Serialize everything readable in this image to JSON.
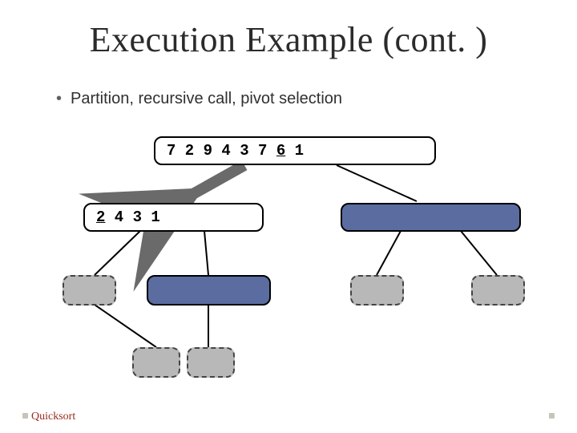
{
  "title": "Execution Example (cont. )",
  "bullet": "Partition, recursive call, pivot selection",
  "footer": "Quicksort",
  "colors": {
    "brand_footer": "#9a2a1e",
    "node_blue": "#5b6da0",
    "node_gray": "#b8b8b8"
  },
  "chart_data": {
    "type": "tree",
    "title": "Quicksort recursion tree (partial)",
    "root": {
      "values": [
        7,
        2,
        9,
        4,
        3,
        7,
        6,
        1
      ],
      "pivot_index": 6,
      "style": "white",
      "children": [
        {
          "values": [
            2,
            4,
            3,
            1
          ],
          "pivot_index": 0,
          "style": "white",
          "active_edge": true,
          "children": [
            {
              "values": null,
              "style": "gray",
              "children": [
                {
                  "values": null,
                  "style": "gray"
                },
                {
                  "values": null,
                  "style": "gray"
                }
              ]
            },
            {
              "values": null,
              "style": "blue"
            }
          ]
        },
        {
          "values": null,
          "style": "blue",
          "children": [
            {
              "values": null,
              "style": "gray"
            },
            {
              "values": null,
              "style": "gray"
            }
          ]
        }
      ]
    }
  },
  "nodes": {
    "root_pre": "7 2 9 4 3 7 ",
    "root_pivot": "6",
    "root_post": " 1",
    "left_pivot": "2",
    "left_post": " 4 3 1"
  }
}
